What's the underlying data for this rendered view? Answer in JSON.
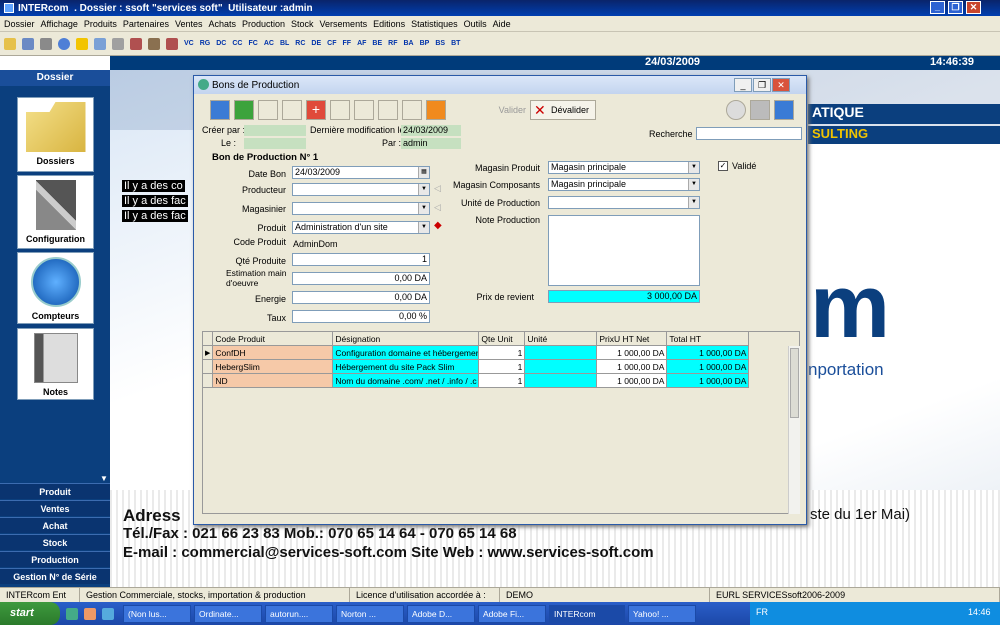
{
  "app": {
    "title": "INTERcom",
    "dossier": ". Dossier : ssoft",
    "company": "\"services soft\"",
    "user": "Utilisateur :admin",
    "date": "24/03/2009",
    "time": "14:46:39"
  },
  "menu": [
    "Dossier",
    "Affichage",
    "Produits",
    "Partenaires",
    "Ventes",
    "Achats",
    "Production",
    "Stock",
    "Versements",
    "Editions",
    "Statistiques",
    "Outils",
    "Aide"
  ],
  "toolbar_codes": [
    "VC",
    "RG",
    "DC",
    "CC",
    "FC",
    "AC",
    "BL",
    "RC",
    "DE",
    "CF",
    "FF",
    "AF",
    "BE",
    "RF",
    "BA",
    "BP",
    "BS",
    "BT"
  ],
  "sidebar": {
    "header": "Dossier",
    "buttons": [
      "Dossiers",
      "Configuration",
      "Compteurs",
      "Notes"
    ],
    "nav": [
      "Produit",
      "Ventes",
      "Achat",
      "Stock",
      "Production",
      "Gestion N° de Série"
    ]
  },
  "background": {
    "notice": "Il y a des co",
    "notice2": "Il y a des fac",
    "notice3": "Il y a des fac",
    "atique": "ATIQUE",
    "consulting": "SULTING",
    "m": "m",
    "importation": "nportation",
    "adresse": "Adress",
    "mai": "ste du 1er Mai)",
    "tel": "Tél./Fax : 021 66 23 83  Mob.: 070 65 14 64 - 070 65 14 68",
    "email": "E-mail : commercial@services-soft.com  Site Web : www.services-soft.com"
  },
  "dialog": {
    "title": "Bons de Production",
    "valider": "Valider",
    "devalider": "Dévalider",
    "cree_par": "Créer par :",
    "le": "Le :",
    "derniere_modif": "Dernière modification le :",
    "derniere_modif_value": "24/03/2009",
    "par": "Par :",
    "par_value": "admin",
    "recherche": "Recherche",
    "bon_title": "Bon de Production N° 1",
    "labels": {
      "date_bon": "Date Bon",
      "producteur": "Producteur",
      "magasinier": "Magasinier",
      "produit": "Produit",
      "code_produit": "Code Produit",
      "qte_produite": "Qté Produite",
      "estimation": "Estimation main d'oeuvre",
      "energie": "Energie",
      "taux": "Taux",
      "magasin_produit": "Magasin Produit",
      "magasin_composants": "Magasin Composants",
      "unite_production": "Unité de Production",
      "note_production": "Note Production",
      "prix_revient": "Prix de revient",
      "valide": "Validé"
    },
    "values": {
      "date_bon": "24/03/2009",
      "produit": "Administration d'un site",
      "code_produit": "AdminDom",
      "qte_produite": "1",
      "estimation": "0,00 DA",
      "energie": "0,00 DA",
      "taux": "0,00 %",
      "magasin_produit": "Magasin principale",
      "magasin_composants": "Magasin principale",
      "prix_revient": "3 000,00 DA"
    },
    "grid": {
      "headers": [
        "Code Produit",
        "Désignation",
        "Qte Unit",
        "Unité",
        "PrixU HT Net",
        "Total HT"
      ],
      "rows": [
        [
          "ConfDH",
          "Configuration domaine et hébergement",
          "1",
          "",
          "1 000,00 DA",
          "1 000,00 DA"
        ],
        [
          "HebergSlim",
          "Hébergement du site Pack Slim",
          "1",
          "",
          "1 000,00 DA",
          "1 000,00 DA"
        ],
        [
          "ND",
          "Nom du domaine .com/ .net / .info / .c",
          "1",
          "",
          "1 000,00 DA",
          "1 000,00 DA"
        ]
      ]
    }
  },
  "status": [
    "INTERcom Ent",
    "Gestion Commerciale, stocks, importation & production",
    "Licence d'utilisation accordée à :",
    "DEMO",
    "EURL SERVICESsoft2006-2009"
  ],
  "taskbar": {
    "items": [
      "(Non lus...",
      "Ordinate...",
      "autorun....",
      "Norton ...",
      "Adobe D...",
      "Adobe Fi...",
      "INTERcom",
      "Yahoo! ..."
    ],
    "lang": "FR",
    "clock": "14:46"
  }
}
